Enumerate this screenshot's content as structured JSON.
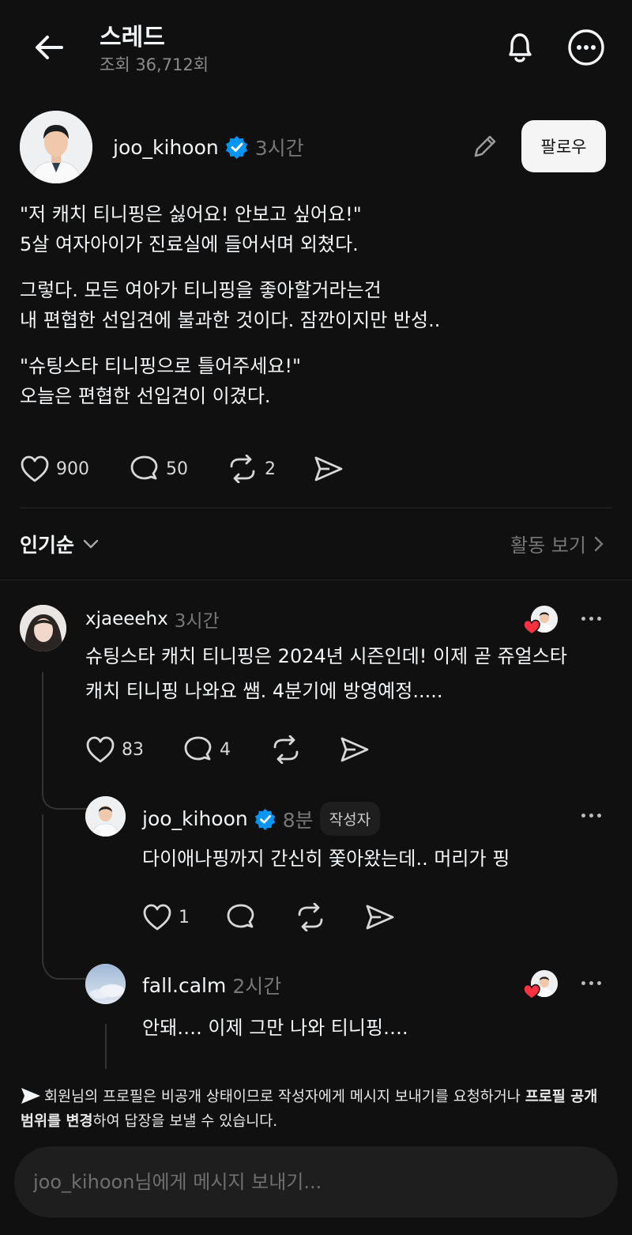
{
  "header": {
    "title": "스레드",
    "views": "조회 36,712회",
    "back_icon": "arrow-left-icon",
    "bell_icon": "bell-icon",
    "more_icon": "more-circle-icon"
  },
  "post": {
    "username": "joo_kihoon",
    "time": "3시간",
    "follow_label": "팔로우",
    "paragraphs": [
      [
        "\"저 캐치 티니핑은 싫어요! 안보고 싶어요!\"",
        "5살 여자아이가 진료실에 들어서며 외쳤다."
      ],
      [
        "그렇다. 모든 여아가 티니핑을 좋아할거라는건",
        "내 편협한 선입견에 불과한 것이다. 잠깐이지만 반성.."
      ],
      [
        "\"슈팅스타 티니핑으로 틀어주세요!\"",
        "오늘은 편협한 선입견이 이겼다."
      ]
    ],
    "likes": "900",
    "comments": "50",
    "reposts": "2"
  },
  "sort": {
    "label": "인기순",
    "activity_label": "활동 보기"
  },
  "comments": [
    {
      "username": "xjaeeehx",
      "time": "3시간",
      "lines": [
        "슈팅스타 캐치 티니핑은 2024년 시즌인데! 이제 곧 쥬얼스타",
        "캐치 티니핑 나와요 쌤. 4분기에 방영예정....."
      ],
      "likes": "83",
      "replies": "4"
    },
    {
      "username": "joo_kihoon",
      "time": "8분",
      "badge": "작성자",
      "lines": [
        "다이애나핑까지 간신히 쫓아왔는데.. 머리가 핑"
      ],
      "likes": "1"
    },
    {
      "username": "fall.calm",
      "time": "2시간",
      "lines": [
        "안돼….  이제 그만 나와 티니핑…."
      ]
    }
  ],
  "notice": {
    "part1": "회원님의 프로필은 비공개 상태이므로 작성자에게 메시지 보내기를 요청하거나 ",
    "bold1": "프로필 공개 범위를 변경",
    "part2": "하여 답장을 보낼 수 있습니다."
  },
  "message_input": {
    "placeholder": "joo_kihoon님에게 메시지 보내기..."
  },
  "colors": {
    "background": "#101010",
    "verified": "#0095f6",
    "heart": "#ff3040"
  }
}
